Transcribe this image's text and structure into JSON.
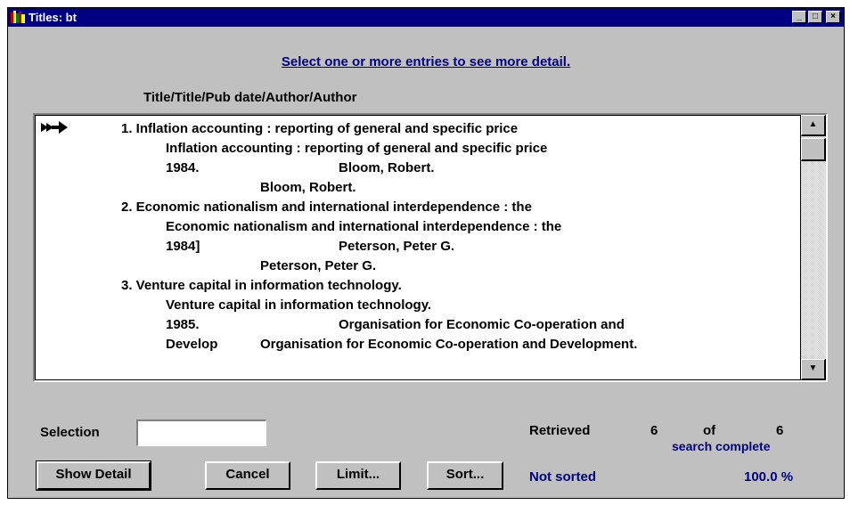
{
  "window": {
    "title": "Titles: bt",
    "controls": {
      "minimize": "_",
      "maximize": "□",
      "close": "×"
    }
  },
  "prompt": "Select one or more entries to see more detail.",
  "column_header": "Title/Title/Pub date/Author/Author",
  "list": {
    "lines": [
      "1. Inflation accounting : reporting of general and specific price",
      "Inflation accounting : reporting of general and specific price",
      "1984.",
      "Bloom, Robert.",
      "Bloom, Robert.",
      "2. Economic nationalism and international interdependence : the",
      "Economic nationalism and international interdependence : the",
      "1984]",
      "Peterson, Peter G.",
      "Peterson, Peter G.",
      "3. Venture capital in information technology.",
      "Venture capital in information technology.",
      "1985.",
      "Organisation for Economic Co-operation and",
      "Develop",
      "Organisation for Economic Co-operation and Development."
    ],
    "scroll_up": "▲",
    "scroll_down": "▼"
  },
  "selection": {
    "label": "Selection",
    "value": ""
  },
  "buttons": {
    "show_detail": "Show Detail",
    "cancel": "Cancel",
    "limit": "Limit...",
    "sort": "Sort..."
  },
  "status": {
    "retrieved_label": "Retrieved",
    "retrieved": "6",
    "of_label": "of",
    "total": "6",
    "search_status": "search complete",
    "sort_status": "Not sorted",
    "percent": "100.0 %"
  },
  "colors": {
    "titlebar": "#000080",
    "face": "#c0c0c0",
    "accent_text": "#000080"
  },
  "icons": {
    "app": "books-icon",
    "pointer": "pointer-arrow-icon"
  }
}
